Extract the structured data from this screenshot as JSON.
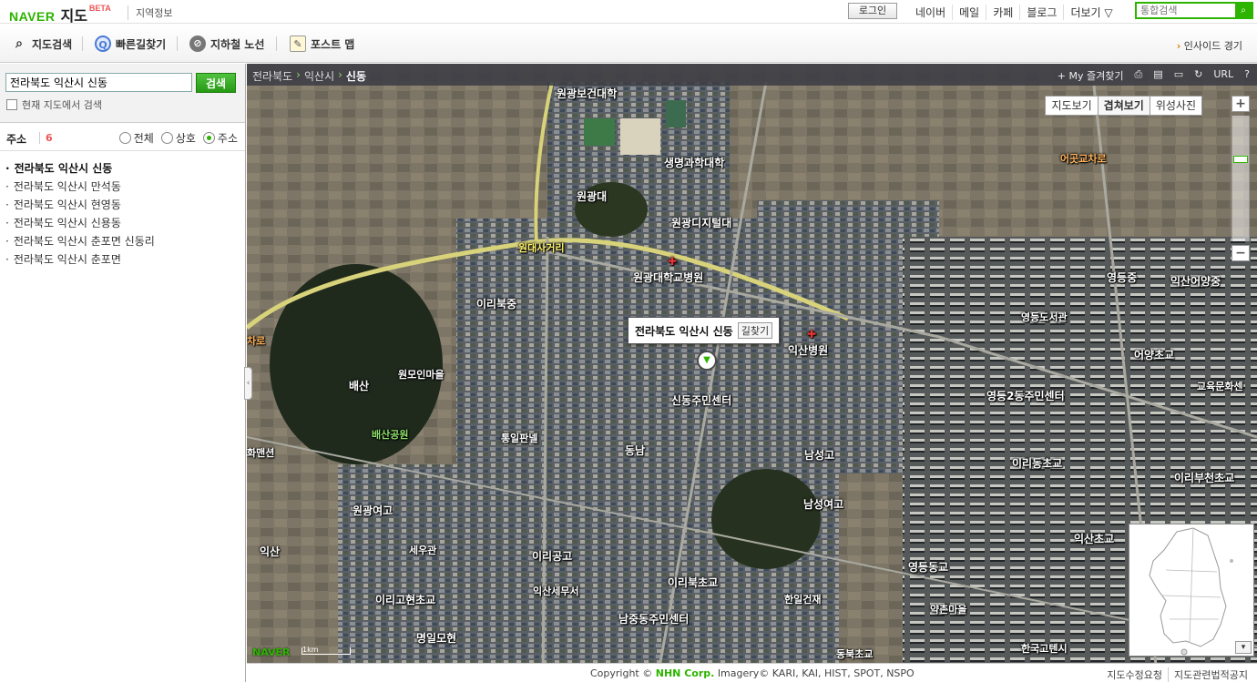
{
  "header": {
    "brand": "NAVER",
    "product": "지도",
    "beta": "BETA",
    "region_link": "지역정보",
    "login": "로그인",
    "links": [
      "네이버",
      "메일",
      "카페",
      "블로그",
      "더보기 ▽"
    ],
    "search_placeholder": "통합검색"
  },
  "menu": {
    "items": [
      "지도검색",
      "빠른길찾기",
      "지하철 노선",
      "포스트 맵"
    ],
    "insight": "인사이드 경기"
  },
  "left": {
    "search_value": "전라북도 익산시 신동",
    "search_button": "검색",
    "current_map_checkbox": "현재 지도에서 검색",
    "result_title": "주소",
    "result_count": "6",
    "radios": [
      "전체",
      "상호",
      "주소"
    ],
    "results": [
      "전라북도 익산시 신동",
      "전라북도 익산시 만석동",
      "전라북도 익산시 현영동",
      "전라북도 익산시 신용동",
      "전라북도 익산시 춘포면 신동리",
      "전라북도 익산시 춘포면"
    ]
  },
  "map": {
    "breadcrumb": [
      "전라북도",
      "익산시",
      "신동"
    ],
    "tools": [
      "+ My 즐겨찾기",
      "⎙",
      "▤",
      "▭",
      "↻",
      "URL",
      "?"
    ],
    "types": [
      "지도보기",
      "겹쳐보기",
      "위성사진"
    ],
    "zoom_in": "+",
    "zoom_out": "−",
    "popup_title": "전라북도 익산시 신동",
    "popup_button": "길찾기",
    "labels": [
      "원광보건대학",
      "생명과학대학",
      "원광대",
      "원광디지털대",
      "원대사거리",
      "원광대학교병원",
      "이리북중",
      "익산병원",
      "영등도서관",
      "영등중",
      "익산어양중",
      "어양초교",
      "어곳교차로",
      "배산",
      "원모인마을",
      "배산공원",
      "신동주민센터",
      "통일판넬",
      "동남",
      "남성고",
      "남성여고",
      "영등2동주민센터",
      "교육문화센",
      "이리동초교",
      "이리부천초교",
      "화맨션",
      "원광여고",
      "세우관",
      "이리공고",
      "익산",
      "이리북초교",
      "익산세무서",
      "영등동교",
      "익산초교",
      "한일건재",
      "약촌마을",
      "이리고현초교",
      "남중동주민센터",
      "명일모현",
      "동북초교",
      "한국고텐시",
      "차로"
    ],
    "scale": "1km",
    "watermark": "NAVER",
    "copyright_prefix": "Copyright ©",
    "copyright_company": "NHN Corp.",
    "copyright_suffix": "Imagery© KARI, KAI, HIST, SPOT, NSPO",
    "footer_links": [
      "지도수정요청",
      "지도관련법적공지"
    ]
  },
  "colors": {
    "brand_green": "#2db400",
    "accent_orange": "#e37b00",
    "count_red": "#e55555"
  }
}
